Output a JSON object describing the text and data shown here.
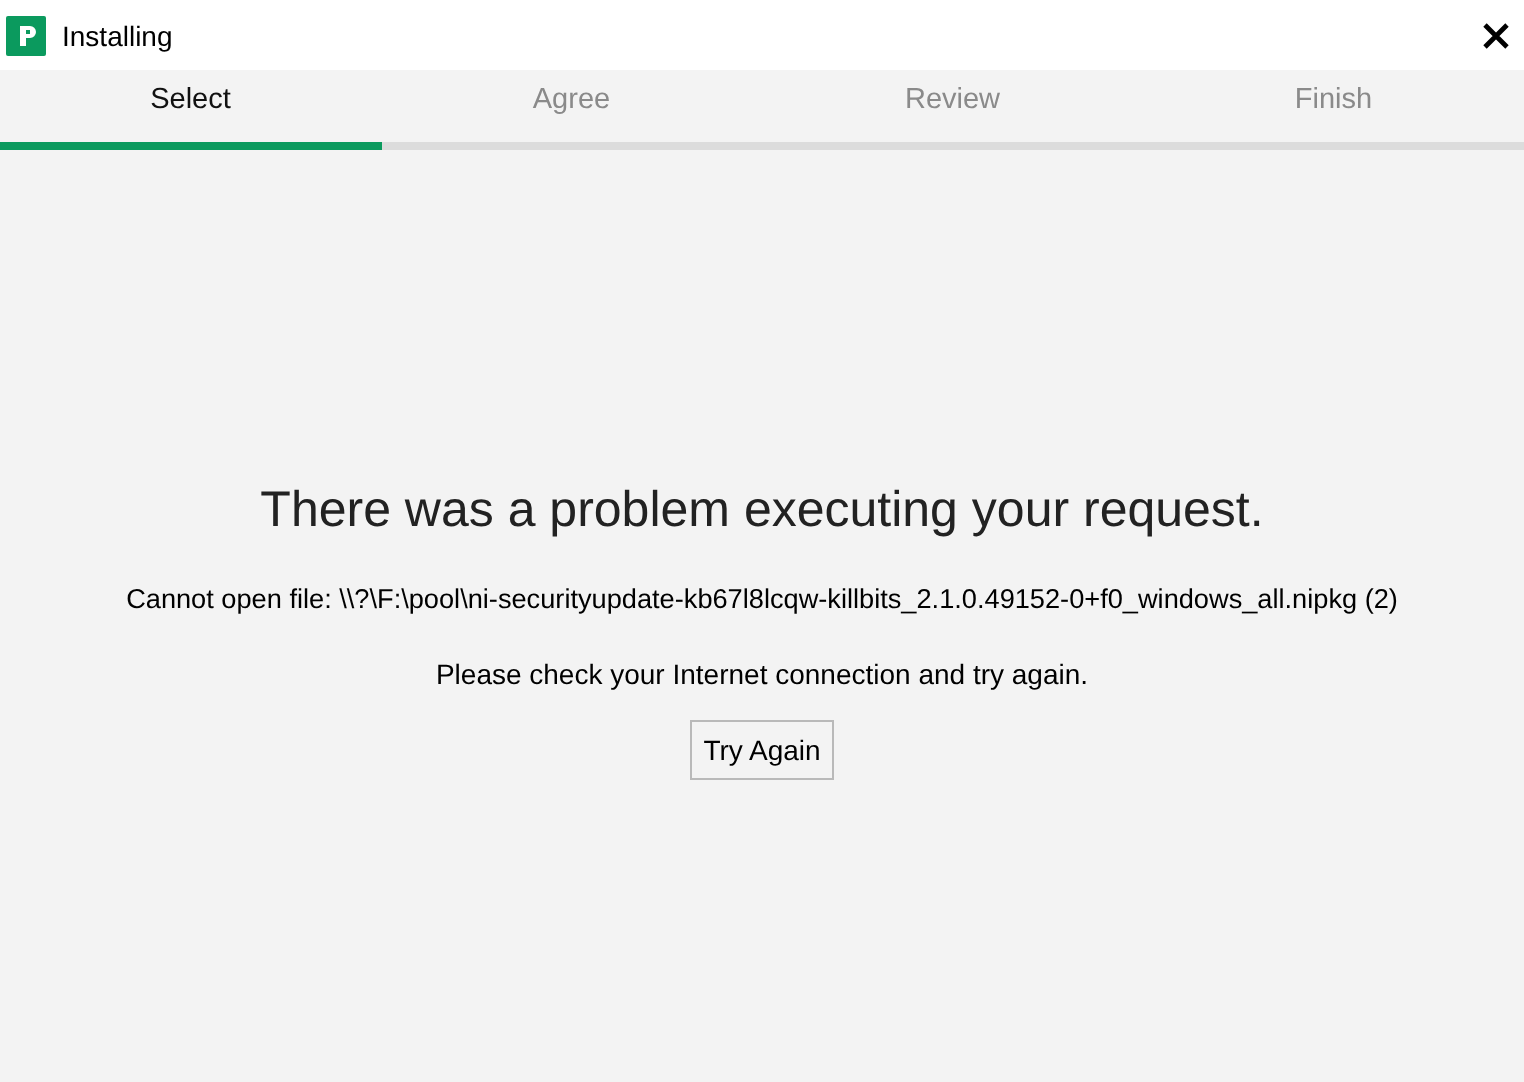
{
  "window": {
    "title": "Installing"
  },
  "tabs": [
    {
      "label": "Select",
      "selected": true
    },
    {
      "label": "Agree",
      "selected": false
    },
    {
      "label": "Review",
      "selected": false
    },
    {
      "label": "Finish",
      "selected": false
    }
  ],
  "error": {
    "heading": "There was a problem executing your request.",
    "detail": "Cannot open file: \\\\?\\F:\\pool\\ni-securityupdate-kb67l8lcqw-killbits_2.1.0.49152-0+f0_windows_all.nipkg (2)",
    "hint": "Please check your Internet connection and try again.",
    "button": "Try Again"
  }
}
